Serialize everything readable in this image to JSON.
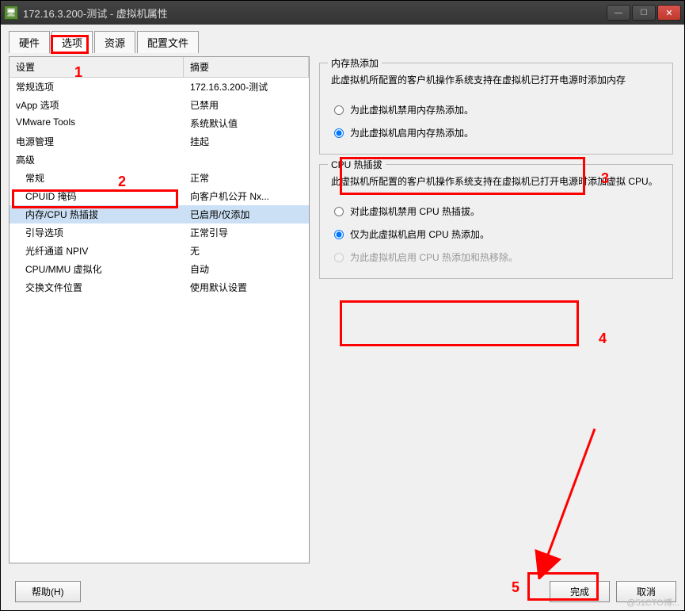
{
  "window": {
    "title": "172.16.3.200-测试 - 虚拟机属性"
  },
  "tabs": [
    {
      "label": "硬件",
      "active": false
    },
    {
      "label": "选项",
      "active": true
    },
    {
      "label": "资源",
      "active": false
    },
    {
      "label": "配置文件",
      "active": false
    }
  ],
  "left": {
    "header_setting": "设置",
    "header_summary": "摘要",
    "rows": [
      {
        "name": "常规选项",
        "summary": "172.16.3.200-测试",
        "indent": 0
      },
      {
        "name": "vApp 选项",
        "summary": "已禁用",
        "indent": 0
      },
      {
        "name": "VMware Tools",
        "summary": "系统默认值",
        "indent": 0
      },
      {
        "name": "电源管理",
        "summary": "挂起",
        "indent": 0
      },
      {
        "name": "高级",
        "summary": "",
        "indent": 0
      },
      {
        "name": "常规",
        "summary": "正常",
        "indent": 1
      },
      {
        "name": "CPUID 掩码",
        "summary": "向客户机公开 Nx...",
        "indent": 1
      },
      {
        "name": "内存/CPU 热插拔",
        "summary": "已启用/仅添加",
        "indent": 1,
        "selected": true
      },
      {
        "name": "引导选项",
        "summary": "正常引导",
        "indent": 1
      },
      {
        "name": "光纤通道 NPIV",
        "summary": "无",
        "indent": 1
      },
      {
        "name": "CPU/MMU 虚拟化",
        "summary": "自动",
        "indent": 1
      },
      {
        "name": "交换文件位置",
        "summary": "使用默认设置",
        "indent": 1
      }
    ]
  },
  "right": {
    "mem": {
      "title": "内存热添加",
      "desc": "此虚拟机所配置的客户机操作系统支持在虚拟机已打开电源时添加内存",
      "radios": [
        {
          "label": "为此虚拟机禁用内存热添加。",
          "checked": false
        },
        {
          "label": "为此虚拟机启用内存热添加。",
          "checked": true
        }
      ]
    },
    "cpu": {
      "title": "CPU 热插拔",
      "desc": "此虚拟机所配置的客户机操作系统支持在虚拟机已打开电源时添加虚拟 CPU。",
      "radios": [
        {
          "label": "对此虚拟机禁用 CPU 热插拔。",
          "checked": false,
          "disabled": false
        },
        {
          "label": "仅为此虚拟机启用 CPU 热添加。",
          "checked": true,
          "disabled": false
        },
        {
          "label": "为此虚拟机启用 CPU 热添加和热移除。",
          "checked": false,
          "disabled": true
        }
      ]
    }
  },
  "footer": {
    "help": "帮助(H)",
    "ok": "完成",
    "cancel": "取消"
  },
  "annotations": {
    "n1": "1",
    "n2": "2",
    "n3": "3",
    "n4": "4",
    "n5": "5"
  },
  "watermark": "@51CTO博..."
}
